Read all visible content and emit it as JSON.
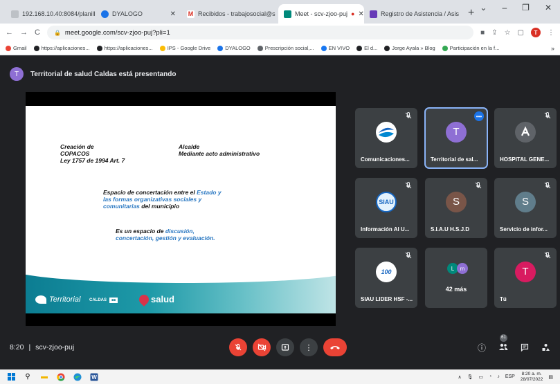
{
  "browser": {
    "tabs": [
      {
        "title": "192.168.10.40:8084/planilla",
        "icon_color": "#9aa0a6"
      },
      {
        "title": "DYALOGO",
        "icon_color": "#1a73e8"
      },
      {
        "title": "Recibidos - trabajosocial@s",
        "icon_color": "#d93025"
      },
      {
        "title": "Meet - scv-zjoo-puj",
        "icon_color": "#00897b",
        "active": true
      },
      {
        "title": "Registro de Asistencia / Asis",
        "icon_color": "#673ab7"
      }
    ],
    "url": "meet.google.com/scv-zjoo-puj?pli=1",
    "profile_letter": "T",
    "bookmarks": [
      {
        "label": "Gmail",
        "color": "#ea4335"
      },
      {
        "label": "https://aplicaciones...",
        "color": "#202124"
      },
      {
        "label": "https://aplicaciones...",
        "color": "#202124"
      },
      {
        "label": "IPS - Google Drive",
        "color": "#fbbc04"
      },
      {
        "label": "DYALOGO",
        "color": "#1a73e8"
      },
      {
        "label": "Prescripción social,...",
        "color": "#5f6368"
      },
      {
        "label": "EN VIVO",
        "color": "#1877f2"
      },
      {
        "label": "El d...",
        "color": "#202124"
      },
      {
        "label": "Jorge Ayala » Blog",
        "color": "#202124"
      },
      {
        "label": "Participación en la f...",
        "color": "#34a853"
      }
    ]
  },
  "meet": {
    "presenter_initial": "T",
    "presenting_text": "Territorial de salud Caldas está presentando",
    "slide": {
      "left_block": [
        "Creación de",
        "COPACOS",
        "Ley 1757 de 1994 Art. 7"
      ],
      "right_block": [
        "Alcalde",
        "Mediante acto administrativo"
      ],
      "para1_a": "Espacio de concertación entre el ",
      "para1_b": "Estado",
      "para1_c": " y",
      "para1_d": "las formas organizativas sociales y",
      "para1_e": "comunitarias",
      "para1_f": " del municipio",
      "para2_a": "Es un espacio de ",
      "para2_b": "discusión,",
      "para2_c": "concertación, gestión y evaluación.",
      "footer_territorial": "Territorial",
      "footer_caldas": "CALDAS",
      "footer_salud": "salud"
    },
    "tiles": [
      {
        "name": "Comunicaciones...",
        "initial": "",
        "color": "#1565c0"
      },
      {
        "name": "Territorial de sal...",
        "initial": "T",
        "color": "#8e6fd4"
      },
      {
        "name": "HOSPITAL GENE...",
        "initial": "",
        "color": "#3c4043"
      },
      {
        "name": "Información Al U...",
        "initial": "SIAU",
        "color": "#1565c0"
      },
      {
        "name": "S.I.A.U H.S.J.D",
        "initial": "S",
        "color": "#795548"
      },
      {
        "name": "Servicio de infor...",
        "initial": "S",
        "color": "#607d8b"
      },
      {
        "name": "SIAU LIDER HSF -...",
        "initial": "100",
        "color": "#1565c0"
      },
      {
        "name": "",
        "initial": "",
        "color": ""
      },
      {
        "name": "Tú",
        "initial": "T",
        "color": "#d81b60"
      }
    ],
    "more": {
      "text": "42 más",
      "a": "L",
      "a_color": "#00897b",
      "b": "m",
      "b_color": "#8e6fd4"
    },
    "time": "8:20",
    "meeting_code": "scv-zjoo-puj",
    "participants_count": "61"
  },
  "taskbar": {
    "lang": "ESP",
    "time": "8:20 a. m.",
    "date": "28/07/2022"
  }
}
